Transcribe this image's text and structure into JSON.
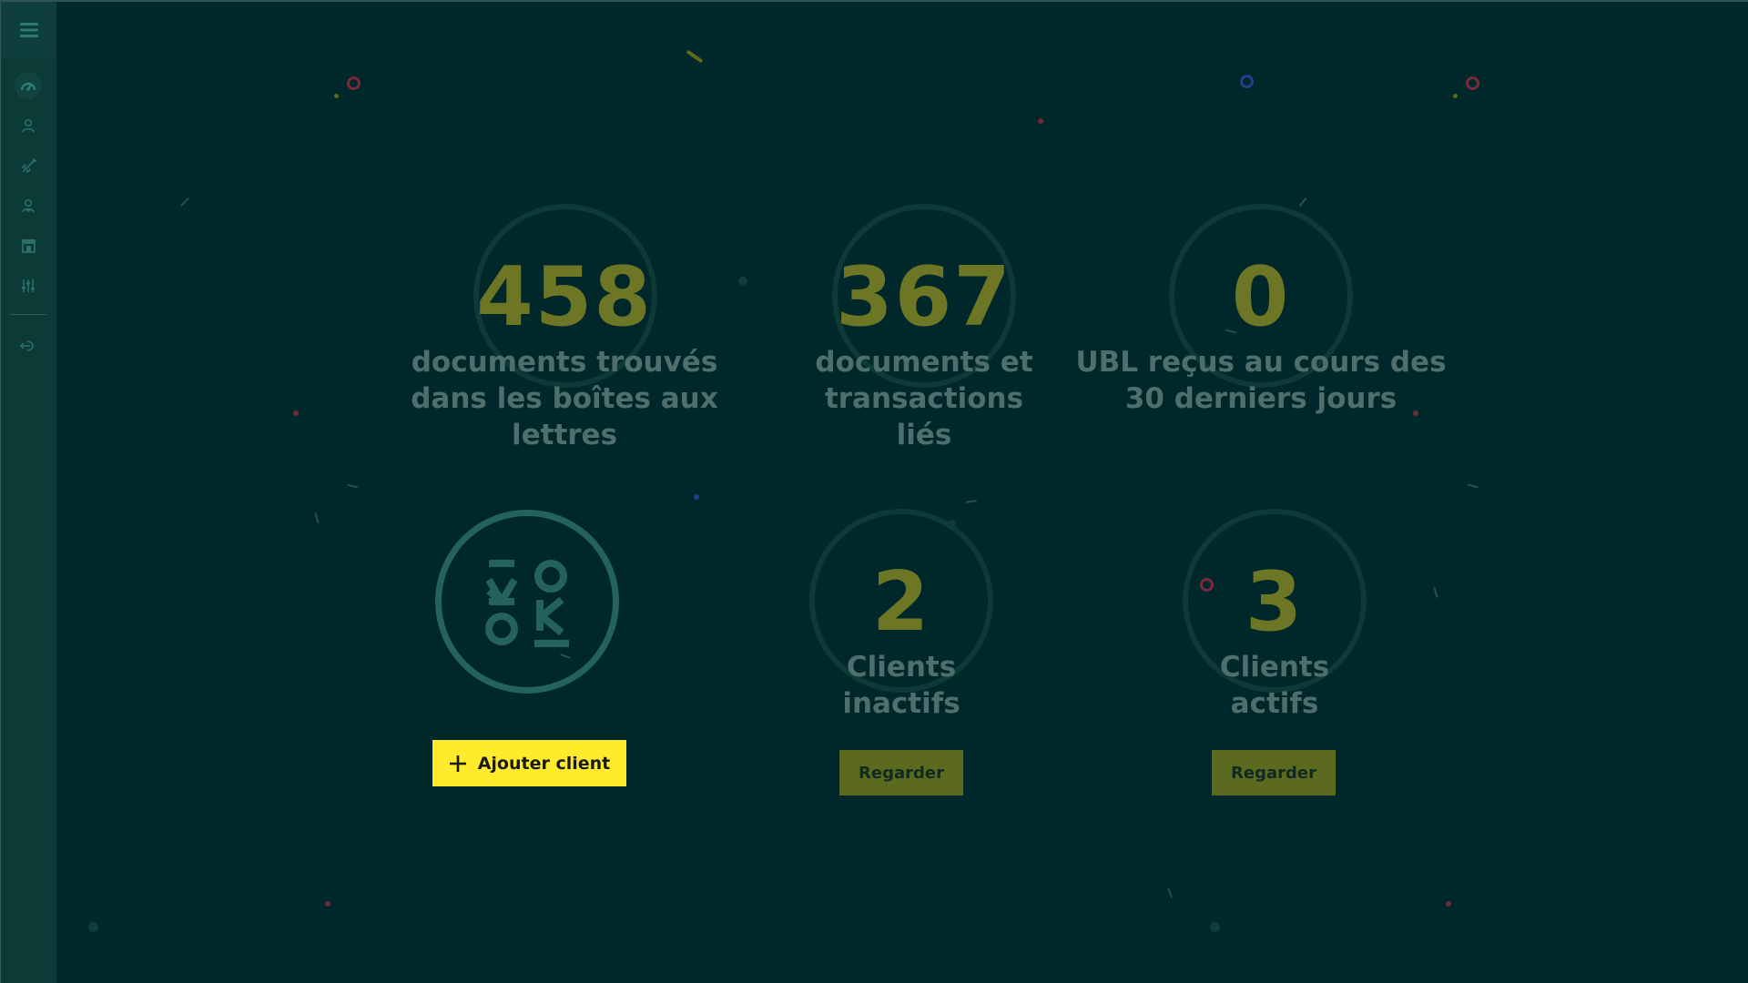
{
  "sidebar": {
    "menu_icon": "hamburger-menu-icon",
    "items": [
      {
        "icon": "dashboard-gauge-icon",
        "active": true
      },
      {
        "icon": "user-icon"
      },
      {
        "icon": "rocket-icon"
      },
      {
        "icon": "users-icon"
      },
      {
        "icon": "store-icon"
      },
      {
        "icon": "sliders-icon"
      },
      {
        "icon": "logout-icon"
      }
    ]
  },
  "stats": {
    "documents_found": {
      "value": "458",
      "label": "documents trouvés\ndans les boîtes aux lettres"
    },
    "linked_documents": {
      "value": "367",
      "label": "documents et\ntransactions\nliés"
    },
    "ubl_received": {
      "value": "0",
      "label": "UBL reçus au cours des\n30 derniers jours"
    },
    "inactive_clients": {
      "value": "2",
      "label": "Clients\ninactifs",
      "button": "Regarder"
    },
    "active_clients": {
      "value": "3",
      "label": "Clients\nactifs",
      "button": "Regarder"
    }
  },
  "brand": {
    "logo_icon": "okioki-logo-icon",
    "add_client_label": "Ajouter client"
  },
  "colors": {
    "background": "#00272a",
    "sidebar": "#0b3a37",
    "number": "#6d7624",
    "label": "#4f6f6d",
    "accent_yellow": "#ffea2b",
    "button_olive": "#5c6a1f",
    "logo_teal": "#24625d"
  }
}
